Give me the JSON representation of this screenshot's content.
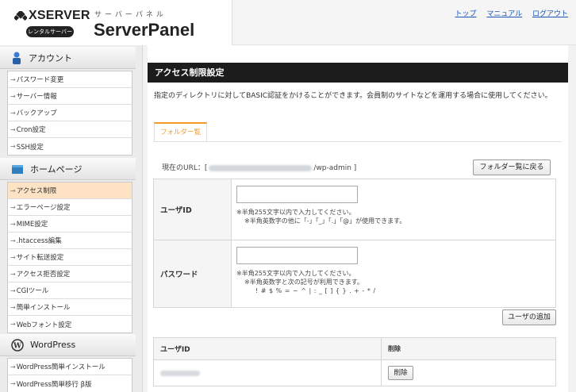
{
  "header": {
    "brand": "XSERVER",
    "badge": "レンタルサーバー",
    "kana": "サーバーパネル",
    "product": "ServerPanel",
    "links": [
      "トップ",
      "マニュアル",
      "ログアウト"
    ]
  },
  "sidebar": {
    "account": {
      "title": "アカウント",
      "items": [
        "パスワード変更",
        "サーバー情報",
        "バックアップ",
        "Cron設定",
        "SSH設定"
      ]
    },
    "homepage": {
      "title": "ホームページ",
      "items": [
        "アクセス制限",
        "エラーページ設定",
        "MIME設定",
        ".htaccess編集",
        "サイト転送設定",
        "アクセス拒否設定",
        "CGIツール",
        "簡単インストール",
        "Webフォント設定"
      ],
      "active_index": 0
    },
    "wordpress": {
      "title": "WordPress",
      "items": [
        "WordPress簡単インストール",
        "WordPress簡単移行 β版"
      ]
    }
  },
  "main": {
    "title": "アクセス制限設定",
    "description": "指定のディレクトリに対してBASIC認証をかけることができます。会員制のサイトなどを運用する場合に使用してください。",
    "tab": "フォルダー覧",
    "url_label": "現在のURL：[",
    "url_suffix": "/wp-admin ]",
    "back_button": "フォルダー覧に戻る",
    "user_label": "ユーザID",
    "user_note1": "※半角255文字以内で入力してください。",
    "user_note2": "※半角英数字の他に「-」「_」「.」「@」が使用できます。",
    "password_label": "パスワード",
    "pw_note1": "※半角255文字以内で入力してください。",
    "pw_note2": "※半角英数字と次の記号が利用できます。",
    "pw_note3": "! # $ % = ~ ^ | : _ [ ] { } . + - * /",
    "add_button": "ユーザの追加",
    "list_header_user": "ユーザID",
    "list_header_delete": "削除",
    "delete_button": "削除"
  },
  "colors": {
    "accent": "#f39a2b",
    "title_bar": "#1c1c1c",
    "link": "#1a55b4",
    "active_menu": "#fde3c4"
  }
}
